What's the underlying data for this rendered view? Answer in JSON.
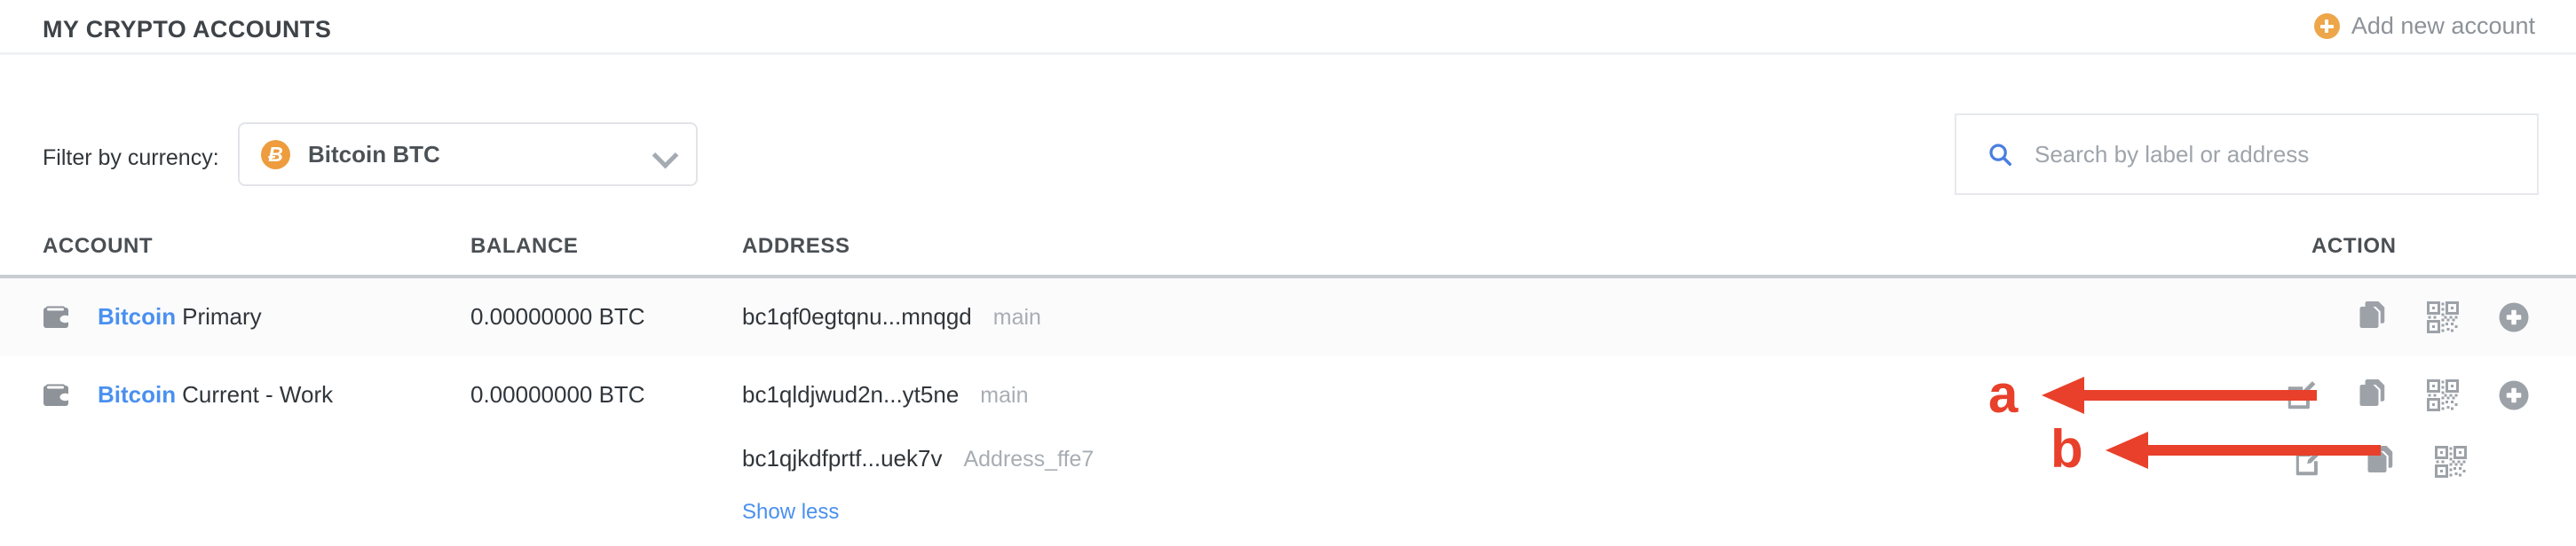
{
  "header": {
    "title": "MY CRYPTO ACCOUNTS",
    "add_account_label": "Add new account",
    "add_icon": "plus-circle-icon",
    "accent_orange": "#eda64a"
  },
  "filter": {
    "label": "Filter by currency:",
    "dropdown": {
      "value": "Bitcoin BTC",
      "coin_symbol": "Ƀ",
      "coin_icon": "bitcoin-coin-icon",
      "chevron_icon": "chevron-down-icon"
    }
  },
  "search": {
    "placeholder": "Search by label or address",
    "value": "",
    "icon": "search-icon",
    "icon_color": "#4a7ee0"
  },
  "table": {
    "columns": [
      "ACCOUNT",
      "BALANCE",
      "ADDRESS",
      "ACTION"
    ],
    "rows": [
      {
        "wallet_icon": "wallet-icon",
        "coin": "Bitcoin",
        "label": "Primary",
        "balance": "0.00000000 BTC",
        "address": "bc1qf0egtqnu...mnqgd",
        "address_tag": "main",
        "actions": [
          "copy-icon",
          "qr-code-icon",
          "plus-circle-icon"
        ]
      },
      {
        "wallet_icon": "wallet-icon",
        "coin": "Bitcoin",
        "label": "Current - Work",
        "balance": "0.00000000 BTC",
        "address": "bc1qldjwud2n...yt5ne",
        "address_tag": "main",
        "actions": [
          "edit-icon",
          "copy-icon",
          "qr-code-icon",
          "plus-circle-icon"
        ]
      }
    ],
    "sub_row": {
      "address": "bc1qjkdfprtf...uek7v",
      "address_tag": "Address_ffe7",
      "actions": [
        "edit-icon",
        "copy-icon",
        "qr-code-icon"
      ]
    },
    "show_less_label": "Show less"
  },
  "annotations": {
    "color": "#e8402a",
    "items": [
      {
        "letter": "a"
      },
      {
        "letter": "b"
      }
    ]
  }
}
